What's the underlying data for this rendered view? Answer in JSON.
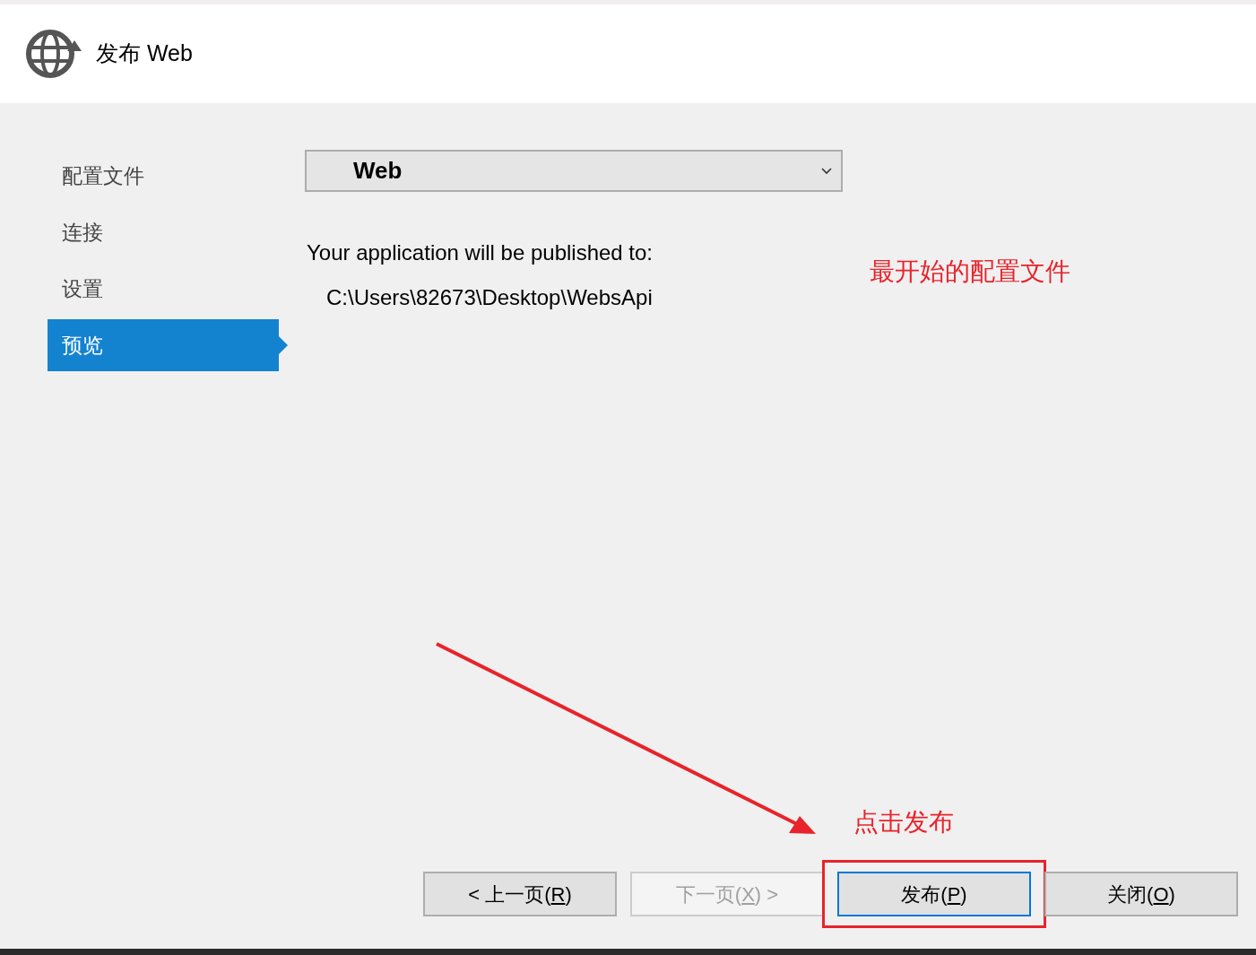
{
  "window": {
    "title": "发布 Web"
  },
  "sidebar": {
    "items": [
      {
        "label": "配置文件",
        "selected": false
      },
      {
        "label": "连接",
        "selected": false
      },
      {
        "label": "设置",
        "selected": false
      },
      {
        "label": "预览",
        "selected": true
      }
    ]
  },
  "profile_dropdown": {
    "value": "Web"
  },
  "publish_info": {
    "heading": "Your application will be published to:",
    "path": "C:\\Users\\82673\\Desktop\\WebsApi"
  },
  "annotations": [
    {
      "kind": "note",
      "text": "最开始的配置文件"
    },
    {
      "kind": "arrow-note",
      "text": "点击发布"
    }
  ],
  "buttons": [
    {
      "before": "< 上一页(",
      "key": "R",
      "after": ")",
      "disabled": false,
      "focused": false,
      "highlighted": false
    },
    {
      "before": "下一页(",
      "key": "X",
      "after": ") >",
      "disabled": true,
      "focused": false,
      "highlighted": false
    },
    {
      "before": "发布(",
      "key": "P",
      "after": ")",
      "disabled": false,
      "focused": true,
      "highlighted": true
    },
    {
      "before": "关闭(",
      "key": "O",
      "after": ")",
      "disabled": false,
      "focused": false,
      "highlighted": false
    }
  ]
}
